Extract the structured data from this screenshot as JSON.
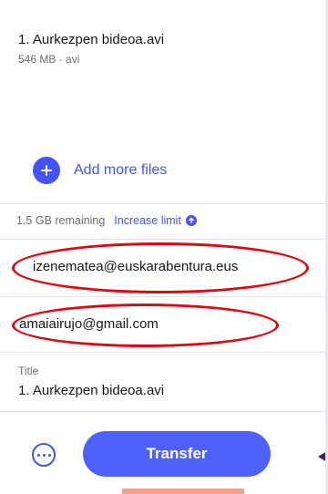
{
  "file": {
    "name": "1. Aurkezpen bideoa.avi",
    "meta": "546 MB · avi"
  },
  "add_more": {
    "label": "Add more files",
    "icon": "plus-icon"
  },
  "quota": {
    "remaining": "1.5 GB remaining",
    "link_label": "Increase limit",
    "link_icon": "arrow-up-icon"
  },
  "fields": {
    "email_to": "izenematea@euskarabentura.eus",
    "your_email": "amaiairujo@gmail.com",
    "title_label": "Title",
    "title_value": "1. Aurkezpen bideoa.avi"
  },
  "actions": {
    "more_icon": "more-options-icon",
    "transfer_label": "Transfer"
  },
  "colors": {
    "accent": "#4353ff",
    "button": "#4e62fb",
    "annotation": "#e00612"
  }
}
